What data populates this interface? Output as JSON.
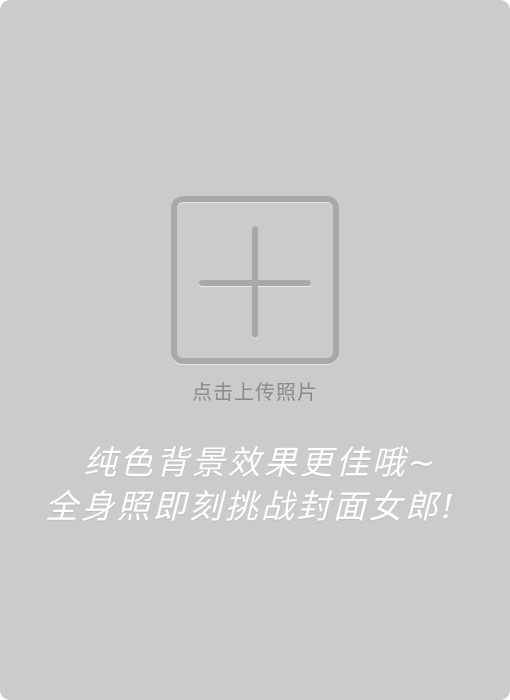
{
  "upload": {
    "label": "点击上传照片",
    "icon": "plus-icon"
  },
  "tagline": {
    "line1": "纯色背景效果更佳哦~",
    "line2": "全身照即刻挑战封面女郎!"
  },
  "colors": {
    "panel_background": "#cbcbcb",
    "icon_gray": "#a9a9a9",
    "label_gray": "#8a8a8a",
    "tagline_white": "#ffffff"
  }
}
